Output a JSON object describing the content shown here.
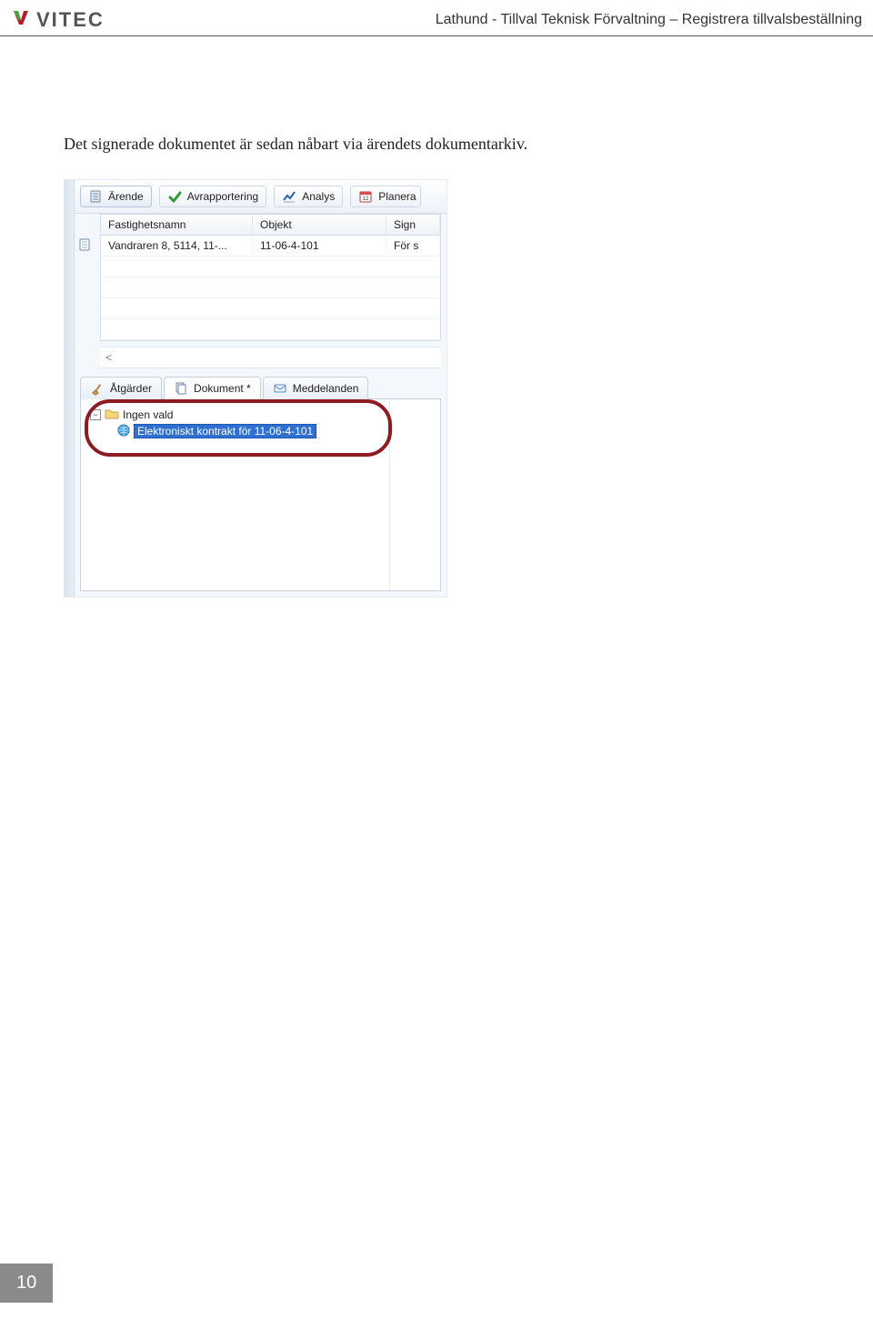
{
  "header": {
    "logo_text": "VITEC",
    "doc_title": "Lathund - Tillval Teknisk Förvaltning – Registrera tillvalsbeställning"
  },
  "body": {
    "intro_text": "Det signerade dokumentet är sedan nåbart via ärendets dokumentarkiv."
  },
  "screenshot": {
    "top_tabs": [
      {
        "label": "Ärende",
        "icon": "document-icon",
        "active": true
      },
      {
        "label": "Avrapportering",
        "icon": "check-icon",
        "active": false
      },
      {
        "label": "Analys",
        "icon": "chart-icon",
        "active": false
      },
      {
        "label": "Planera",
        "icon": "calendar-icon",
        "active": false
      }
    ],
    "grid": {
      "columns": [
        "Fastighetsnamn",
        "Objekt",
        "Sign"
      ],
      "rows": [
        {
          "c1": "Vandraren 8,  5114, 11-...",
          "c2": "11-06-4-101",
          "c3": "För s"
        }
      ],
      "scroll_left_glyph": "<"
    },
    "lower_tabs": [
      {
        "label": "Åtgärder",
        "icon": "brush-icon",
        "active": false
      },
      {
        "label": "Dokument *",
        "icon": "doc-list-icon",
        "active": true
      },
      {
        "label": "Meddelanden",
        "icon": "message-icon",
        "active": false
      }
    ],
    "tree": {
      "root_label": "Ingen vald",
      "child_label": "Elektroniskt kontrakt för 11-06-4-101"
    }
  },
  "footer": {
    "page_number": "10"
  }
}
